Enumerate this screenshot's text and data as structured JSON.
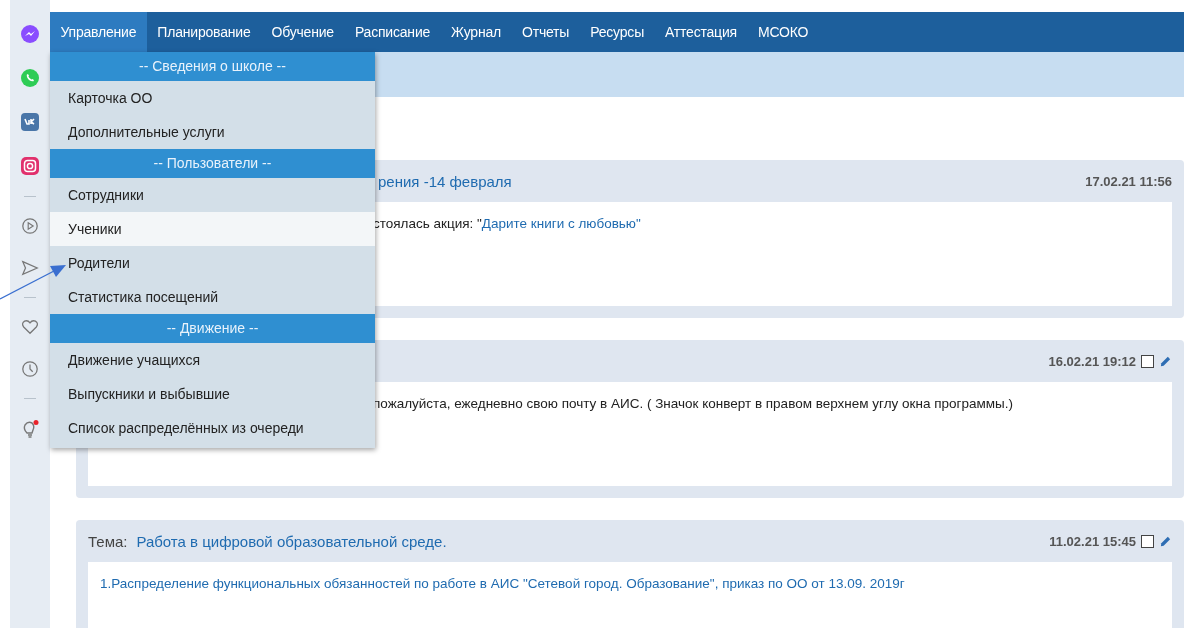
{
  "nav": {
    "tabs": [
      {
        "label": "Управление",
        "selected": true
      },
      {
        "label": "Планирование",
        "selected": false
      },
      {
        "label": "Обучение",
        "selected": false
      },
      {
        "label": "Расписание",
        "selected": false
      },
      {
        "label": "Журнал",
        "selected": false
      },
      {
        "label": "Отчеты",
        "selected": false
      },
      {
        "label": "Ресурсы",
        "selected": false
      },
      {
        "label": "Аттестация",
        "selected": false
      },
      {
        "label": "МСОКО",
        "selected": false
      }
    ]
  },
  "dropdown": {
    "sections": [
      {
        "header": "-- Сведения о школе --",
        "items": [
          {
            "label": "Карточка ОО",
            "selected": false
          },
          {
            "label": "Дополнительные услуги",
            "selected": false
          }
        ]
      },
      {
        "header": "-- Пользователи --",
        "items": [
          {
            "label": "Сотрудники",
            "selected": false
          },
          {
            "label": "Ученики",
            "selected": true
          },
          {
            "label": "Родители",
            "selected": false
          },
          {
            "label": "Статистика посещений",
            "selected": false
          }
        ]
      },
      {
        "header": "-- Движение --",
        "items": [
          {
            "label": "Движение учащихся",
            "selected": false
          },
          {
            "label": "Выпускники и выбывшие",
            "selected": false
          },
          {
            "label": "Список распределённых из очереди",
            "selected": false
          }
        ]
      }
    ]
  },
  "posts": [
    {
      "kind": "covered",
      "title": "рения -14 февраля",
      "date": "17.02.21 11:56",
      "body": "стоялась акция: \"",
      "link": "Дарите книги с любовью\"",
      "tools": false
    },
    {
      "kind": "covered",
      "date": "16.02.21 19:12",
      "body": "пожалуйста, ежедневно  свою почту в АИС. ( Значок конверт в правом верхнем углу окна программы.)",
      "tools": true,
      "checked": false
    },
    {
      "kind": "full",
      "topic_label": "Тема:",
      "title": "Работа в цифровой образовательной среде.",
      "date": "11.02.21 15:45",
      "link": "1.Распределение функциональных обязанностей по работе в АИС \"Сетевой город. Образование\", приказ по ОО от 13.09. 2019г",
      "tools": true,
      "checked": false
    }
  ]
}
